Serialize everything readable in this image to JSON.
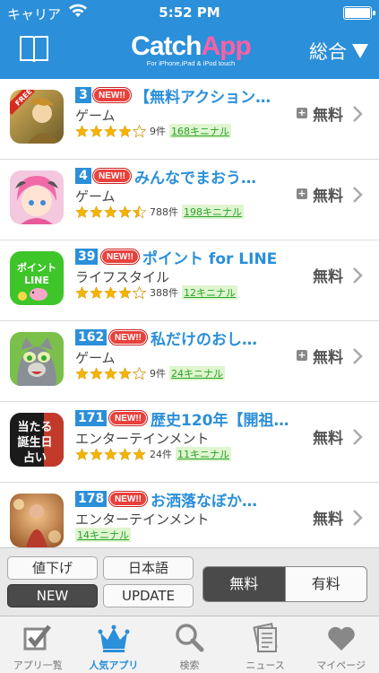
{
  "status": {
    "carrier": "キャリア",
    "time": "5:52 PM"
  },
  "nav": {
    "logo_part1": "Catch",
    "logo_part2": "App",
    "logo_sub": "For iPhone,iPad & iPod touch",
    "category": "総合"
  },
  "apps": [
    {
      "rank": "3",
      "new": "NEW!!",
      "title": "【無料アクション…",
      "genre": "ゲーム",
      "rating": 4,
      "half": false,
      "count": "9件",
      "kinal": "168キニナル",
      "plus": true,
      "price": "無料"
    },
    {
      "rank": "4",
      "new": "NEW!!",
      "title": "みんなでまおう…",
      "genre": "ゲーム",
      "rating": 4,
      "half": true,
      "count": "788件",
      "kinal": "198キニナル",
      "plus": true,
      "price": "無料"
    },
    {
      "rank": "39",
      "new": "NEW!!",
      "title": "ポイント for LINE",
      "genre": "ライフスタイル",
      "rating": 4,
      "half": false,
      "count": "388件",
      "kinal": "12キニナル",
      "plus": false,
      "price": "無料"
    },
    {
      "rank": "162",
      "new": "NEW!!",
      "title": "私だけのおし…",
      "genre": "ゲーム",
      "rating": 4,
      "half": false,
      "count": "9件",
      "kinal": "24キニナル",
      "plus": true,
      "price": "無料"
    },
    {
      "rank": "171",
      "new": "NEW!!",
      "title": "歴史120年【開祖…",
      "genre": "エンターテインメント",
      "rating": 5,
      "half": false,
      "count": "24件",
      "kinal": "11キニナル",
      "plus": false,
      "price": "無料"
    },
    {
      "rank": "178",
      "new": "NEW!!",
      "title": "お洒落なぼか…",
      "genre": "エンターテインメント",
      "rating": 0,
      "half": false,
      "count": "",
      "kinal": "14キニナル",
      "plus": false,
      "price": "無料"
    }
  ],
  "icon_texts": {
    "free": "FREE",
    "line_point": "ポイント\nLINE",
    "uranai": "当たる\n誕生日\n占い"
  },
  "filters": {
    "price_down": "値下げ",
    "japanese": "日本語",
    "new": "NEW",
    "update": "UPDATE",
    "free": "無料",
    "paid": "有料"
  },
  "tabs": [
    {
      "label": "アプリ一覧",
      "icon": "checkbox-icon"
    },
    {
      "label": "人気アプリ",
      "icon": "crown-icon"
    },
    {
      "label": "検索",
      "icon": "magnifier-icon"
    },
    {
      "label": "ニュース",
      "icon": "news-icon"
    },
    {
      "label": "マイページ",
      "icon": "heart-icon"
    }
  ],
  "colors": {
    "brand": "#2b8fd9",
    "new_badge": "#e8413c",
    "star": "#f5b400",
    "kinal": "#2aa22a"
  }
}
